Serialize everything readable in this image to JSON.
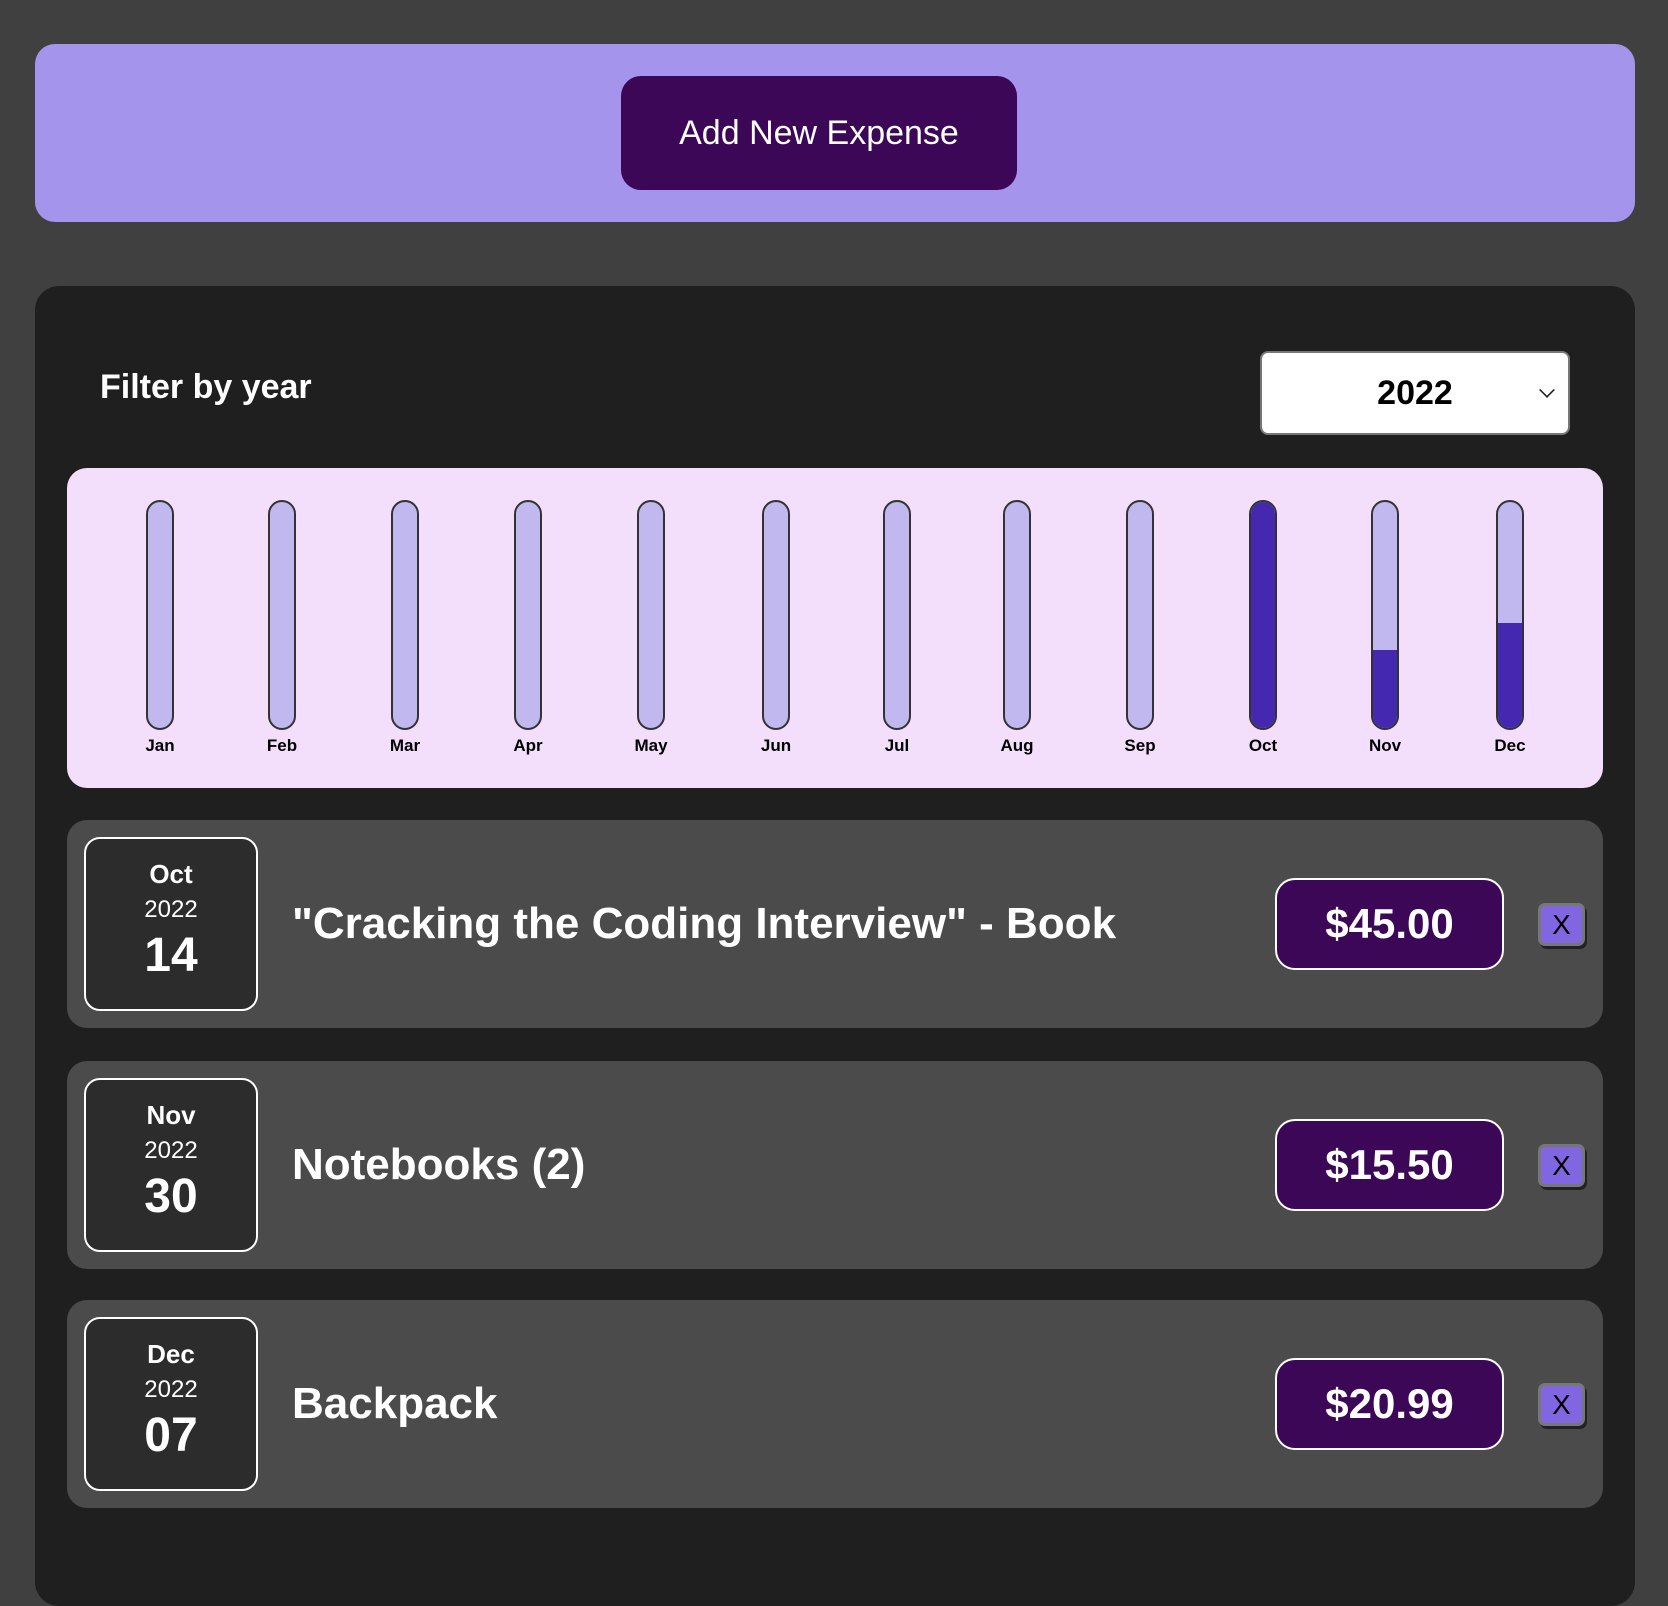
{
  "header": {
    "add_button_label": "Add New Expense"
  },
  "filter": {
    "label": "Filter by year",
    "selected_year": "2022"
  },
  "colors": {
    "accent": "#a594eb",
    "button": "#3b0756",
    "bar_fill": "#4429b0",
    "bar_empty": "#c1b8ef",
    "chart_bg": "#f3dffb"
  },
  "chart_data": {
    "type": "bar",
    "categories": [
      "Jan",
      "Feb",
      "Mar",
      "Apr",
      "May",
      "Jun",
      "Jul",
      "Aug",
      "Sep",
      "Oct",
      "Nov",
      "Dec"
    ],
    "values": [
      0,
      0,
      0,
      0,
      0,
      0,
      0,
      0,
      0,
      45.0,
      15.5,
      20.99
    ],
    "ylim": [
      0,
      45.0
    ]
  },
  "expenses": [
    {
      "month": "Oct",
      "year": "2022",
      "day": "14",
      "title": "\"Cracking the Coding Interview\" - Book",
      "amount": "$45.00",
      "delete_label": "X"
    },
    {
      "month": "Nov",
      "year": "2022",
      "day": "30",
      "title": "Notebooks (2)",
      "amount": "$15.50",
      "delete_label": "X"
    },
    {
      "month": "Dec",
      "year": "2022",
      "day": "07",
      "title": "Backpack",
      "amount": "$20.99",
      "delete_label": "X"
    }
  ]
}
